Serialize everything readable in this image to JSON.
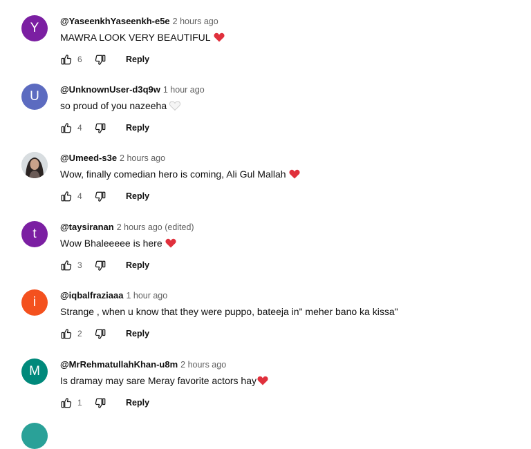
{
  "comments": [
    {
      "avatar_letter": "Y",
      "avatar_color": "#7b1fa2",
      "author": "@YaseenkhYaseenkh-e5e",
      "time": "2 hours ago",
      "text": "MAWRA LOOK VERY BEAUTIFUL",
      "emoji": "red-heart",
      "likes": "6",
      "reply_label": "Reply"
    },
    {
      "avatar_letter": "U",
      "avatar_color": "#5c6bc0",
      "author": "@UnknownUser-d3q9w",
      "time": "1 hour ago",
      "text": "so proud of you nazeeha",
      "emoji": "white-heart",
      "likes": "4",
      "reply_label": "Reply"
    },
    {
      "avatar_letter": "",
      "avatar_color": "#cfd3d6",
      "author": "@Umeed-s3e",
      "time": "2 hours ago",
      "text": "Wow, finally comedian hero is coming, Ali Gul Mallah",
      "emoji": "red-heart",
      "likes": "4",
      "reply_label": "Reply"
    },
    {
      "avatar_letter": "t",
      "avatar_color": "#7b1fa2",
      "author": "@taysiranan",
      "time": "2 hours ago (edited)",
      "text": "Wow Bhaleeeee is here",
      "emoji": "red-heart",
      "likes": "3",
      "reply_label": "Reply"
    },
    {
      "avatar_letter": "i",
      "avatar_color": "#f4511e",
      "author": "@iqbalfraziaaa",
      "time": "1 hour ago",
      "text": "Strange , when u know that they were puppo, bateeja in\" meher bano ka kissa\"",
      "emoji": "",
      "likes": "2",
      "reply_label": "Reply"
    },
    {
      "avatar_letter": "M",
      "avatar_color": "#00897b",
      "author": "@MrRehmatullahKhan-u8m",
      "time": "2 hours ago",
      "text": "Is dramay may sare Meray favorite actors hay",
      "emoji": "red-heart",
      "likes": "1",
      "reply_label": "Reply"
    }
  ]
}
